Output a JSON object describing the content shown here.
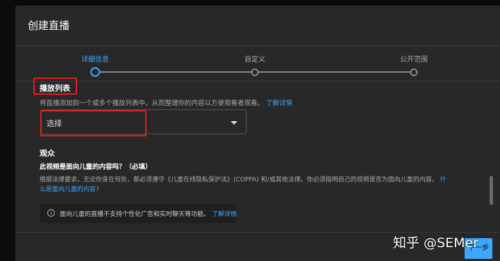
{
  "dialog": {
    "title": "创建直播"
  },
  "stepper": {
    "steps": [
      {
        "label": "详细信息",
        "active": true
      },
      {
        "label": "自定义",
        "active": false
      },
      {
        "label": "公开范围",
        "active": false
      }
    ]
  },
  "playlist": {
    "heading": "播放列表",
    "description": "将直播添加到一个或多个播放列表中，从而整理你的内容以方便观看者观看。",
    "learn_more": "了解详情",
    "select_placeholder": "选择"
  },
  "audience": {
    "heading": "观众",
    "question": "此视频是面向儿童的内容吗？（必填）",
    "description_line1": "根据法律要求，无论你身在何处，都必须遵守《儿童在线隐私保护法》(COPPA) 和/或其他法律。你必须指明自己的视频是否为面向儿童的内容。",
    "link_part1": "什",
    "link_part2": "么是面向儿童的内容?",
    "info_icon": "info-icon",
    "info_text": "面向儿童的直播不支持个性化广告和实时聊天等功能。",
    "info_link": "了解详情"
  },
  "footer": {
    "next_label": "下一步"
  },
  "watermark": "知乎 @SEMer",
  "colors": {
    "accent": "#3ea6ff",
    "highlight": "#e02020",
    "background": "#282828"
  }
}
